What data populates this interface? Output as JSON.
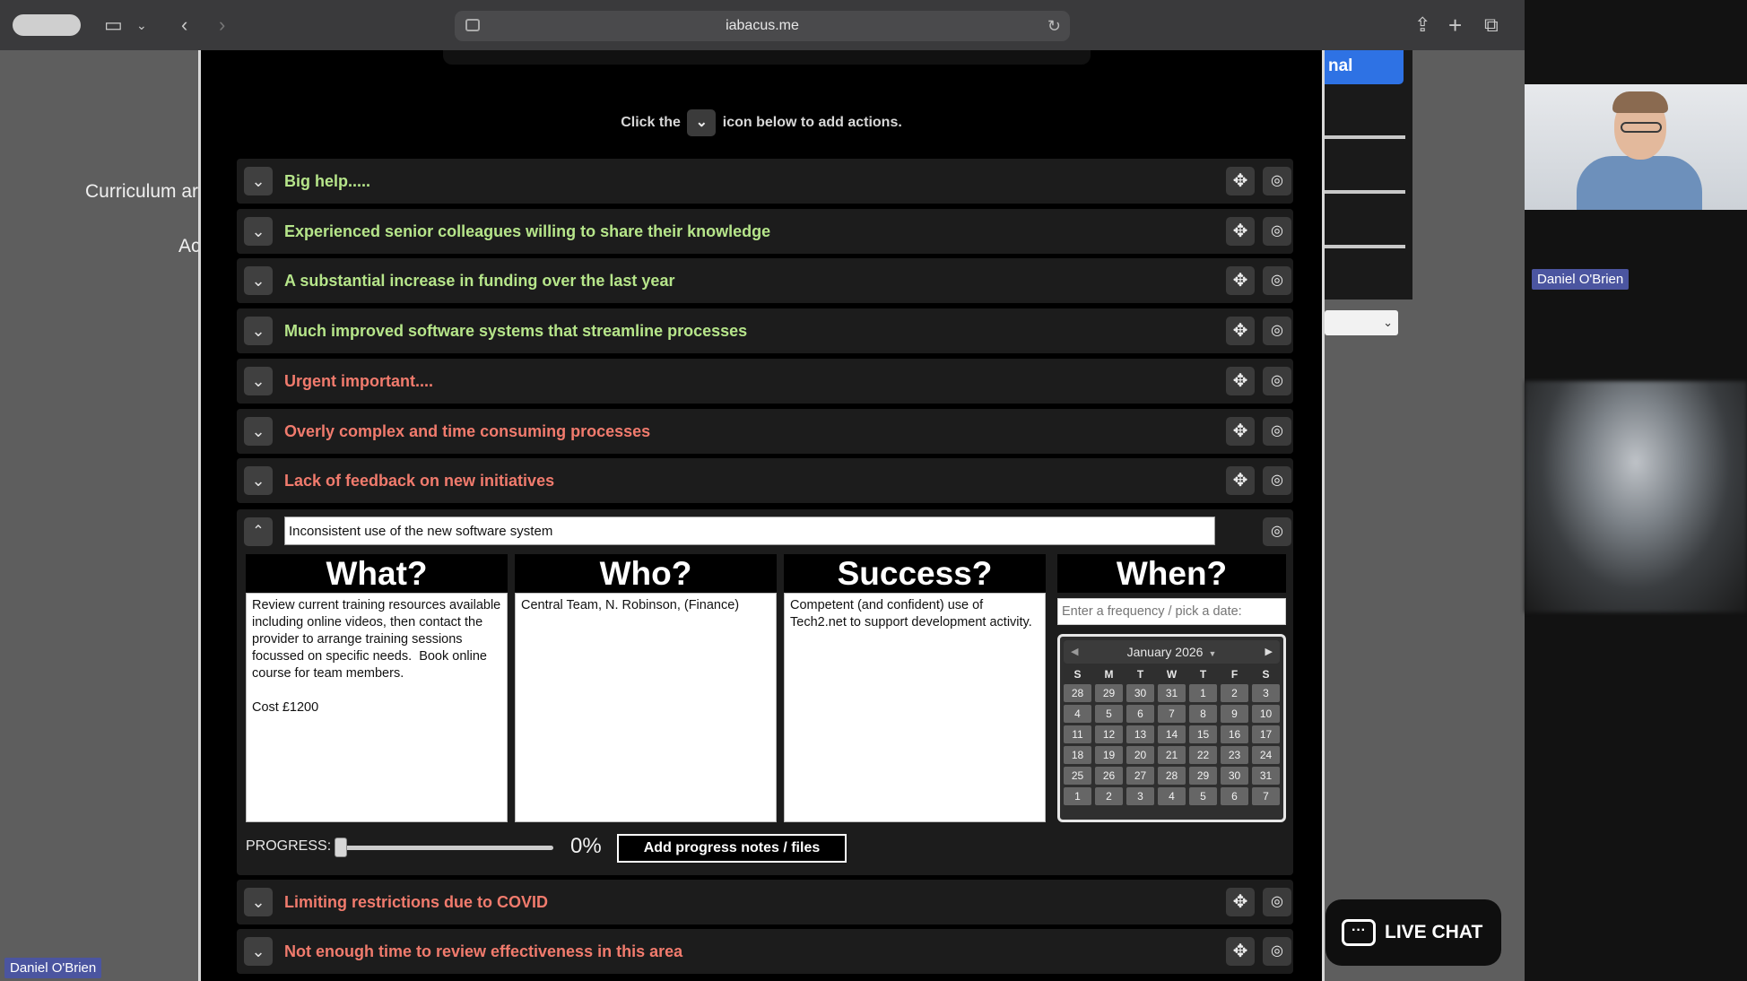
{
  "browser": {
    "url": "iabacus.me"
  },
  "background": {
    "text1": "Curriculum ar",
    "text2": "Ac"
  },
  "instruction": {
    "before": "Click the",
    "after": "icon below to add actions."
  },
  "rows_top": [
    {
      "label": "Big help.....",
      "tone": "green"
    },
    {
      "label": "Experienced senior colleagues willing to share their knowledge",
      "tone": "green"
    },
    {
      "label": "A substantial increase in funding over the last year",
      "tone": "green"
    },
    {
      "label": "Much improved software systems that streamline processes",
      "tone": "green"
    },
    {
      "label": "Urgent important....",
      "tone": "red"
    },
    {
      "label": "Overly complex and time consuming processes",
      "tone": "red"
    },
    {
      "label": "Lack of feedback on new initiatives",
      "tone": "red"
    }
  ],
  "expanded": {
    "title": "Inconsistent use of the new software system",
    "what": {
      "heading": "What?",
      "text": "Review current training resources available including online videos, then contact the provider to arrange training sessions focussed on specific needs.  Book online course for team members.\n\nCost £1200"
    },
    "who": {
      "heading": "Who?",
      "text": "Central Team, N. Robinson, (Finance)"
    },
    "success": {
      "heading": "Success?",
      "text": "Competent (and confident) use of Tech2.net to support development activity."
    },
    "when": {
      "heading": "When?",
      "placeholder": "Enter a frequency / pick a date:",
      "calendar": {
        "month_label": "January 2026",
        "weekdays": [
          "S",
          "M",
          "T",
          "W",
          "T",
          "F",
          "S"
        ],
        "days": [
          "28",
          "29",
          "30",
          "31",
          "1",
          "2",
          "3",
          "4",
          "5",
          "6",
          "7",
          "8",
          "9",
          "10",
          "11",
          "12",
          "13",
          "14",
          "15",
          "16",
          "17",
          "18",
          "19",
          "20",
          "21",
          "22",
          "23",
          "24",
          "25",
          "26",
          "27",
          "28",
          "29",
          "30",
          "31",
          "1",
          "2",
          "3",
          "4",
          "5",
          "6",
          "7"
        ]
      }
    },
    "progress": {
      "label": "PROGRESS:",
      "value": 0,
      "value_text": "0%"
    },
    "notes_button": "Add progress notes / files"
  },
  "rows_bottom": [
    {
      "label": "Limiting restrictions due to COVID",
      "tone": "red"
    },
    {
      "label": "Not enough time to review effectiveness in this area",
      "tone": "red"
    }
  ],
  "side_panel": {
    "accent_text": "nal"
  },
  "live_chat": "LIVE CHAT",
  "video_call": {
    "participant_top": "Daniel O'Brien",
    "participant_bottom": "Daniel O'Brien"
  },
  "colors": {
    "green_label": "#b6e58a",
    "red_label": "#f17b6d",
    "accent_blue": "#2e72e4",
    "name_tag": "#4b55a0"
  }
}
